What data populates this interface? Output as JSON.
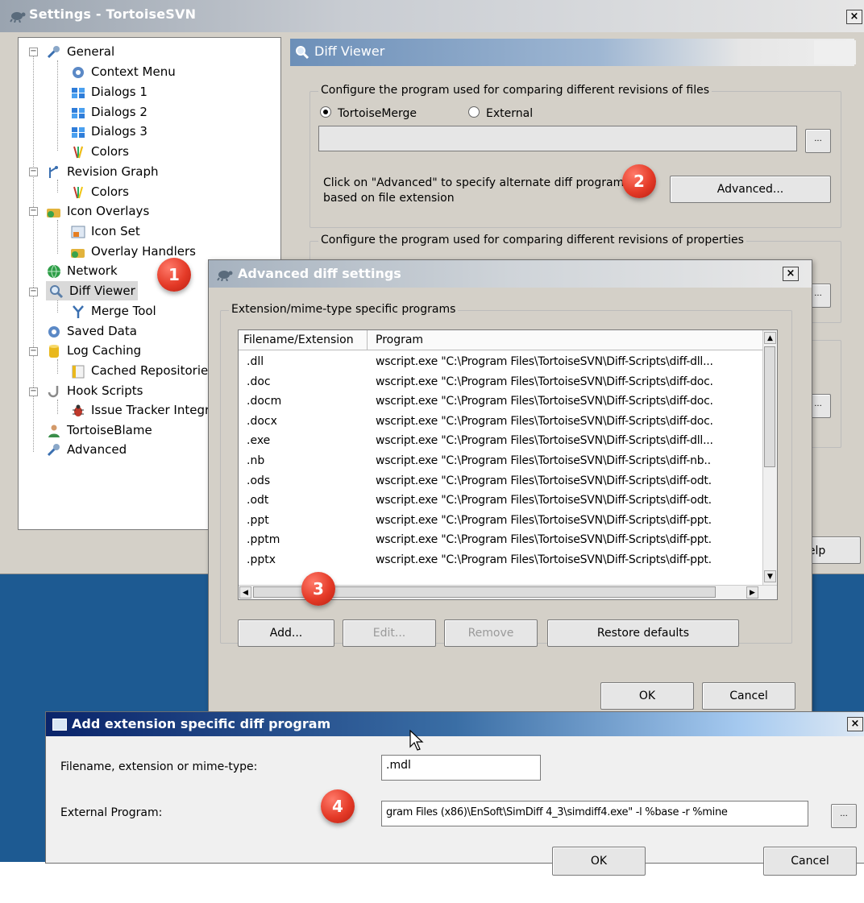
{
  "settings": {
    "title": "Settings - TortoiseSVN",
    "close": "×",
    "tree": [
      {
        "label": "General"
      },
      {
        "label": "Context Menu"
      },
      {
        "label": "Dialogs 1"
      },
      {
        "label": "Dialogs 2"
      },
      {
        "label": "Dialogs 3"
      },
      {
        "label": "Colors"
      },
      {
        "label": "Revision Graph"
      },
      {
        "label": "Colors"
      },
      {
        "label": "Icon Overlays"
      },
      {
        "label": "Icon Set"
      },
      {
        "label": "Overlay Handlers"
      },
      {
        "label": "Network"
      },
      {
        "label": "Diff Viewer"
      },
      {
        "label": "Merge Tool"
      },
      {
        "label": "Saved Data"
      },
      {
        "label": "Log Caching"
      },
      {
        "label": "Cached Repositories"
      },
      {
        "label": "Hook Scripts"
      },
      {
        "label": "Issue Tracker Integration"
      },
      {
        "label": "TortoiseBlame"
      },
      {
        "label": "Advanced"
      }
    ],
    "page_header": "Diff Viewer",
    "group1_legend": "Configure the program used for comparing different revisions of files",
    "radio_tortoisemerge": "TortoiseMerge",
    "radio_external": "External",
    "browse": "...",
    "advanced_hint": "Click on \"Advanced\" to specify alternate diff programs based on file extension",
    "advanced_button": "Advanced...",
    "group2_legend": "Configure the program used for comparing different revisions of properties",
    "help_button_partial": "lelp"
  },
  "advanced_dialog": {
    "title": "Advanced diff settings",
    "close": "×",
    "group_legend": "Extension/mime-type specific programs",
    "columns": [
      "Filename/Extension",
      "Program"
    ],
    "rows": [
      {
        "ext": ".dll",
        "program": "wscript.exe \"C:\\Program Files\\TortoiseSVN\\Diff-Scripts\\diff-dll..."
      },
      {
        "ext": ".doc",
        "program": "wscript.exe \"C:\\Program Files\\TortoiseSVN\\Diff-Scripts\\diff-doc."
      },
      {
        "ext": ".docm",
        "program": "wscript.exe \"C:\\Program Files\\TortoiseSVN\\Diff-Scripts\\diff-doc."
      },
      {
        "ext": ".docx",
        "program": "wscript.exe \"C:\\Program Files\\TortoiseSVN\\Diff-Scripts\\diff-doc."
      },
      {
        "ext": ".exe",
        "program": "wscript.exe \"C:\\Program Files\\TortoiseSVN\\Diff-Scripts\\diff-dll..."
      },
      {
        "ext": ".nb",
        "program": "wscript.exe \"C:\\Program Files\\TortoiseSVN\\Diff-Scripts\\diff-nb.."
      },
      {
        "ext": ".ods",
        "program": "wscript.exe \"C:\\Program Files\\TortoiseSVN\\Diff-Scripts\\diff-odt."
      },
      {
        "ext": ".odt",
        "program": "wscript.exe \"C:\\Program Files\\TortoiseSVN\\Diff-Scripts\\diff-odt."
      },
      {
        "ext": ".ppt",
        "program": "wscript.exe \"C:\\Program Files\\TortoiseSVN\\Diff-Scripts\\diff-ppt."
      },
      {
        "ext": ".pptm",
        "program": "wscript.exe \"C:\\Program Files\\TortoiseSVN\\Diff-Scripts\\diff-ppt."
      },
      {
        "ext": ".pptx",
        "program": "wscript.exe \"C:\\Program Files\\TortoiseSVN\\Diff-Scripts\\diff-ppt."
      }
    ],
    "buttons": {
      "add": "Add...",
      "edit": "Edit...",
      "remove": "Remove",
      "restore": "Restore defaults",
      "ok": "OK",
      "cancel": "Cancel"
    }
  },
  "add_dialog": {
    "title": "Add extension specific diff program",
    "close": "×",
    "ext_label": "Filename, extension or mime-type:",
    "ext_value": ".mdl",
    "program_label": "External Program:",
    "program_value": "gram Files (x86)\\EnSoft\\SimDiff 4_3\\simdiff4.exe\" -l %base -r %mine",
    "browse": "...",
    "ok": "OK",
    "cancel": "Cancel"
  },
  "badges": [
    "1",
    "2",
    "3",
    "4"
  ],
  "colors": {
    "badge": "#e43a27",
    "desktop": "#1d5a92",
    "active_title": "#0a246a"
  }
}
